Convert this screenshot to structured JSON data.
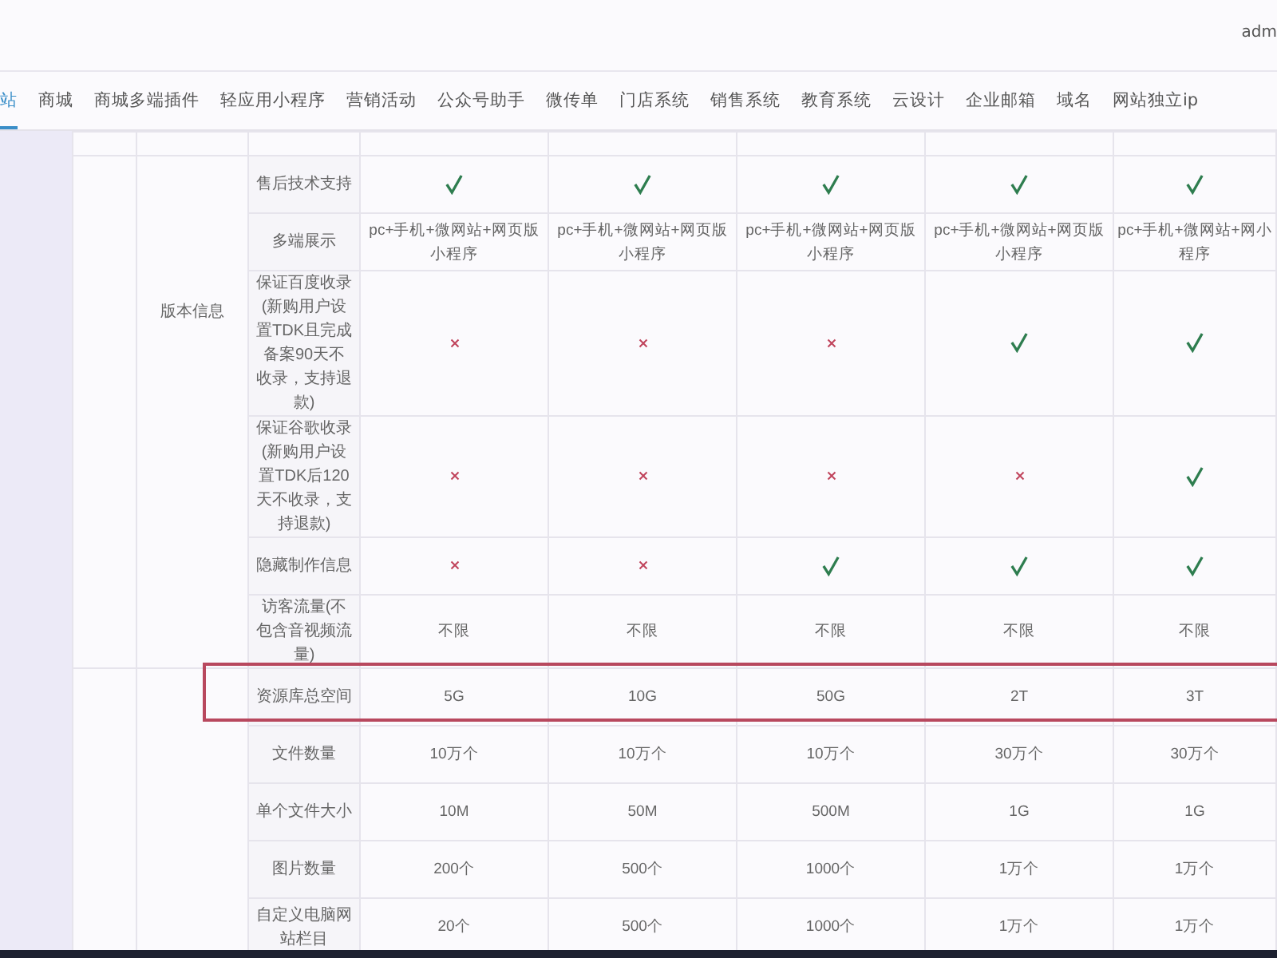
{
  "header": {
    "user": "adm"
  },
  "nav_tabs": [
    {
      "label": "站",
      "selected": true
    },
    {
      "label": "商城",
      "selected": false
    },
    {
      "label": "商城多端插件",
      "selected": false
    },
    {
      "label": "轻应用小程序",
      "selected": false
    },
    {
      "label": "营销活动",
      "selected": false
    },
    {
      "label": "公众号助手",
      "selected": false
    },
    {
      "label": "微传单",
      "selected": false
    },
    {
      "label": "门店系统",
      "selected": false
    },
    {
      "label": "销售系统",
      "selected": false
    },
    {
      "label": "教育系统",
      "selected": false
    },
    {
      "label": "云设计",
      "selected": false
    },
    {
      "label": "企业邮箱",
      "selected": false
    },
    {
      "label": "域名",
      "selected": false
    },
    {
      "label": "网站独立ip",
      "selected": false
    }
  ],
  "table": {
    "groups": [
      {
        "label": "版本信息",
        "rows": [
          {
            "feature": "售后技术支持",
            "highlighted": false,
            "cells": [
              {
                "kind": "check"
              },
              {
                "kind": "check"
              },
              {
                "kind": "check"
              },
              {
                "kind": "check"
              },
              {
                "kind": "check"
              }
            ]
          },
          {
            "feature": "多端展示",
            "highlighted": false,
            "cells": [
              {
                "kind": "text",
                "text": "pc+手机+微网站+网页版小程序"
              },
              {
                "kind": "text",
                "text": "pc+手机+微网站+网页版小程序"
              },
              {
                "kind": "text",
                "text": "pc+手机+微网站+网页版小程序"
              },
              {
                "kind": "text",
                "text": "pc+手机+微网站+网页版小程序"
              },
              {
                "kind": "text",
                "text": "pc+手机+微网站+网小程序"
              }
            ]
          },
          {
            "feature": "保证百度收录(新购用户设置TDK且完成备案90天不收录，支持退款)",
            "highlighted": false,
            "cells": [
              {
                "kind": "cross"
              },
              {
                "kind": "cross"
              },
              {
                "kind": "cross"
              },
              {
                "kind": "check"
              },
              {
                "kind": "check"
              }
            ]
          },
          {
            "feature": "保证谷歌收录(新购用户设置TDK后120天不收录，支持退款)",
            "highlighted": false,
            "cells": [
              {
                "kind": "cross"
              },
              {
                "kind": "cross"
              },
              {
                "kind": "cross"
              },
              {
                "kind": "cross"
              },
              {
                "kind": "check"
              }
            ]
          },
          {
            "feature": "隐藏制作信息",
            "highlighted": false,
            "cells": [
              {
                "kind": "cross"
              },
              {
                "kind": "cross"
              },
              {
                "kind": "check"
              },
              {
                "kind": "check"
              },
              {
                "kind": "check"
              }
            ]
          },
          {
            "feature": "访客流量(不包含音视频流量)",
            "highlighted": false,
            "cells": [
              {
                "kind": "text",
                "text": "不限"
              },
              {
                "kind": "text",
                "text": "不限"
              },
              {
                "kind": "text",
                "text": "不限"
              },
              {
                "kind": "text",
                "text": "不限"
              },
              {
                "kind": "text",
                "text": "不限"
              }
            ]
          }
        ]
      },
      {
        "rows": [
          {
            "feature": "资源库总空间",
            "highlighted": true,
            "cells": [
              {
                "kind": "text",
                "text": "5G"
              },
              {
                "kind": "text",
                "text": "10G"
              },
              {
                "kind": "text",
                "text": "50G"
              },
              {
                "kind": "text",
                "text": "2T"
              },
              {
                "kind": "text",
                "text": "3T"
              }
            ]
          },
          {
            "feature": "文件数量",
            "highlighted": false,
            "cells": [
              {
                "kind": "text",
                "text": "10万个"
              },
              {
                "kind": "text",
                "text": "10万个"
              },
              {
                "kind": "text",
                "text": "10万个"
              },
              {
                "kind": "text",
                "text": "30万个"
              },
              {
                "kind": "text",
                "text": "30万个"
              }
            ]
          },
          {
            "feature": "单个文件大小",
            "highlighted": false,
            "cells": [
              {
                "kind": "text",
                "text": "10M"
              },
              {
                "kind": "text",
                "text": "50M"
              },
              {
                "kind": "text",
                "text": "500M"
              },
              {
                "kind": "text",
                "text": "1G"
              },
              {
                "kind": "text",
                "text": "1G"
              }
            ]
          },
          {
            "feature": "图片数量",
            "highlighted": false,
            "cells": [
              {
                "kind": "text",
                "text": "200个"
              },
              {
                "kind": "text",
                "text": "500个"
              },
              {
                "kind": "text",
                "text": "1000个"
              },
              {
                "kind": "text",
                "text": "1万个"
              },
              {
                "kind": "text",
                "text": "1万个"
              }
            ]
          },
          {
            "feature": "自定义电脑网站栏目",
            "highlighted": false,
            "cells": [
              {
                "kind": "text",
                "text": "20个"
              },
              {
                "kind": "text",
                "text": "500个"
              },
              {
                "kind": "text",
                "text": "1000个"
              },
              {
                "kind": "text",
                "text": "1万个"
              },
              {
                "kind": "text",
                "text": "1万个"
              }
            ]
          }
        ]
      }
    ]
  }
}
